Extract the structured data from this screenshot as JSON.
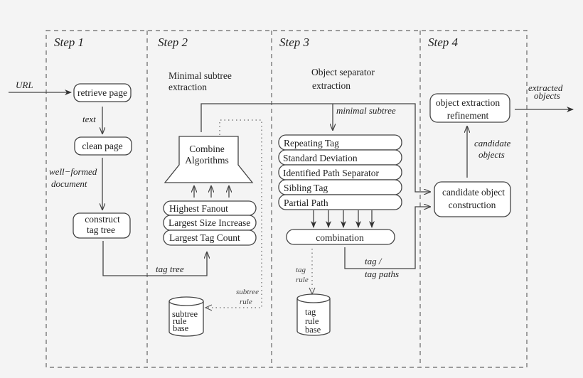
{
  "diagram": {
    "steps": [
      {
        "label": "Step 1"
      },
      {
        "label": "Step 2",
        "subtitle": [
          "Minimal subtree",
          "extraction"
        ]
      },
      {
        "label": "Step 3",
        "subtitle": [
          "Object separator",
          "extraction"
        ]
      },
      {
        "label": "Step 4"
      }
    ],
    "step1": {
      "input_label": "URL",
      "retrieve_page": "retrieve page",
      "text_label": "text",
      "clean_page": "clean page",
      "wellformed_label": [
        "well−formed",
        "document"
      ],
      "construct_tag_tree": [
        "construct",
        "tag tree"
      ],
      "tag_tree_label": "tag tree"
    },
    "step2": {
      "combine": [
        "Combine",
        "Algorithms"
      ],
      "algorithms": [
        "Highest Fanout",
        "Largest Size Increase",
        "Largest Tag Count"
      ],
      "subtree_rule_label": [
        "subtree",
        "rule"
      ],
      "rule_base": [
        "subtree",
        "rule",
        "base"
      ]
    },
    "step3": {
      "minimal_subtree_label": "minimal subtree",
      "heuristics": [
        "Repeating Tag",
        "Standard Deviation",
        "Identified Path Separator",
        "Sibling Tag",
        "Partial Path"
      ],
      "combination": "combination",
      "tag_rule_label": [
        "tag",
        "rule"
      ],
      "tag_paths_label": [
        "tag /",
        "tag paths"
      ],
      "rule_base": [
        "tag",
        "rule",
        "base"
      ]
    },
    "step4": {
      "refinement": [
        "object extraction",
        "refinement"
      ],
      "candidate_label": [
        "candidate",
        "objects"
      ],
      "construction": [
        "candidate object",
        "construction"
      ],
      "output_label": [
        "extracted",
        "objects"
      ]
    }
  }
}
